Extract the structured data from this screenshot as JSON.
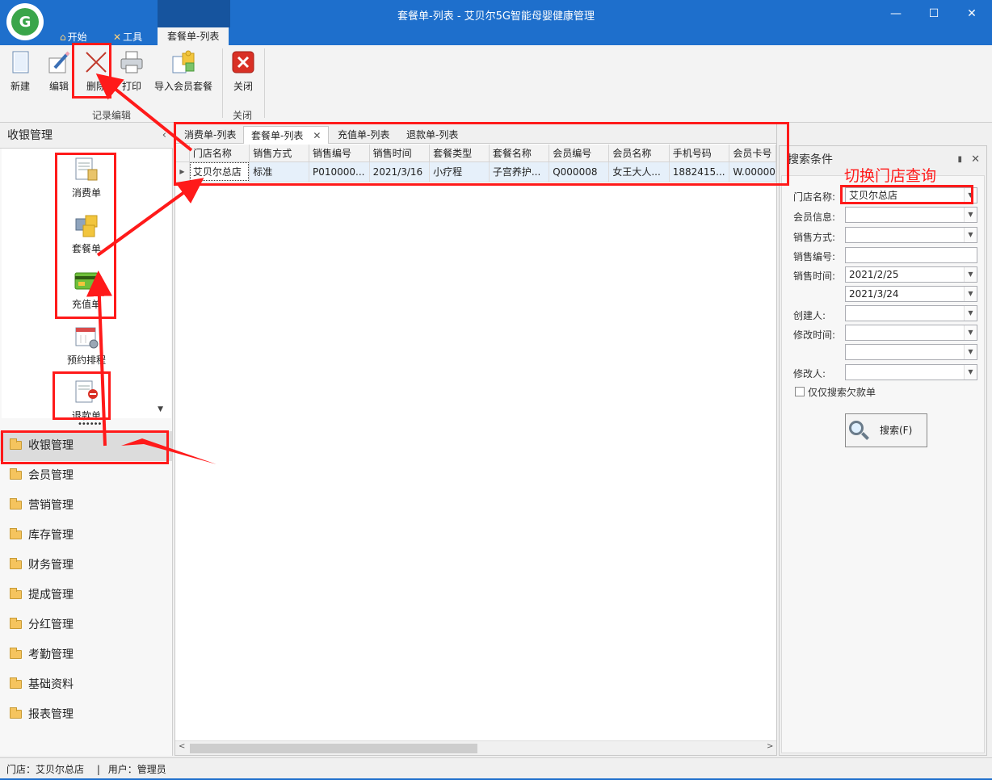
{
  "window": {
    "title": "套餐单-列表 - 艾贝尔5G智能母婴健康管理",
    "logo_text": "G",
    "minimize": "—",
    "maximize": "☐",
    "close": "✕"
  },
  "ribbon_tabs": {
    "start": "开始",
    "tools": "工具",
    "active": "套餐单-列表"
  },
  "toolbar": {
    "new": "新建",
    "edit": "编辑",
    "delete": "删除",
    "print": "打印",
    "import": "导入会员套餐",
    "close": "关闭",
    "group_record": "记录编辑",
    "group_close": "关闭"
  },
  "left_panel": {
    "title": "收银管理",
    "collapse": "‹",
    "items": [
      {
        "label": "消费单",
        "icon": "consume-doc-icon"
      },
      {
        "label": "套餐单",
        "icon": "package-puzzle-icon"
      },
      {
        "label": "充值单",
        "icon": "recharge-card-icon"
      },
      {
        "label": "预约排程",
        "icon": "calendar-icon"
      },
      {
        "label": "退款单",
        "icon": "refund-doc-icon"
      }
    ],
    "scroll_down": "▼",
    "dots": "••••••",
    "accordion": [
      "收银管理",
      "会员管理",
      "营销管理",
      "库存管理",
      "财务管理",
      "提成管理",
      "分红管理",
      "考勤管理",
      "基础资料",
      "报表管理"
    ]
  },
  "doc_tabs": [
    "消费单-列表",
    "套餐单-列表",
    "充值单-列表",
    "退款单-列表"
  ],
  "doc_tab_close": "✕",
  "grid": {
    "columns": [
      "门店名称",
      "销售方式",
      "销售编号",
      "销售时间",
      "套餐类型",
      "套餐名称",
      "会员编号",
      "会员名称",
      "手机号码",
      "会员卡号"
    ],
    "rows": [
      [
        "艾贝尔总店",
        "标准",
        "P010000...",
        "2021/3/16",
        "小疗程",
        "子宫养护...",
        "Q000008",
        "女王大人...",
        "1882415...",
        "W.00000"
      ]
    ],
    "row_indicator": "▶",
    "scroll_left": "<",
    "scroll_right": ">"
  },
  "search_panel": {
    "title": "搜索条件",
    "pin": "▮",
    "close": "✕",
    "annotation": "切换门店查询",
    "fields": [
      {
        "label": "门店名称:",
        "value": "艾贝尔总店"
      },
      {
        "label": "会员信息:",
        "value": ""
      },
      {
        "label": "销售方式:",
        "value": ""
      },
      {
        "label": "销售编号:",
        "value": ""
      },
      {
        "label": "销售时间:",
        "value": "2021/2/25"
      },
      {
        "label": "",
        "value": "2021/3/24"
      },
      {
        "label": "创建人:",
        "value": ""
      },
      {
        "label": "修改时间:",
        "value": ""
      },
      {
        "label": "",
        "value": ""
      },
      {
        "label": "修改人:",
        "value": ""
      }
    ],
    "dropdown_arrow": "▼",
    "only_debt": "仅仅搜索欠款单",
    "search_button": "搜索(F)"
  },
  "statusbar": {
    "store": "门店：艾贝尔总店",
    "sep": "|",
    "user": "用户：管理员"
  },
  "colors": {
    "titlebar": "#1e6fcc",
    "annotation": "#ff1a1a",
    "selected_row": "#e6f0fa"
  }
}
